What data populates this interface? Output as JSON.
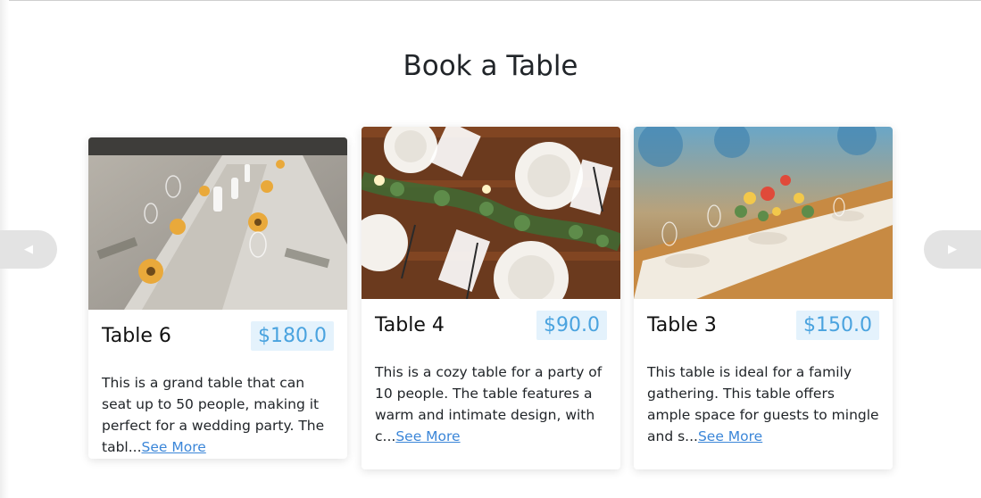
{
  "section": {
    "title": "Book a Table"
  },
  "carousel": {
    "prev_icon": "caret-left-icon",
    "next_icon": "caret-right-icon"
  },
  "cards": [
    {
      "name": "Table 6",
      "price": "$180.0",
      "description": "This is a grand table that can seat up to 50 people, making it perfect for a wedding party. The tabl...",
      "see_more": "See More",
      "image": "table-sunflowers-photo"
    },
    {
      "name": "Table 4",
      "price": "$90.0",
      "description": "This is a cozy table for a party of 10 people. The table features a warm and intimate design, with c...",
      "see_more": "See More",
      "image": "table-greenery-photo"
    },
    {
      "name": "Table 3",
      "price": "$150.0",
      "description": "This table is ideal for a family gathering. This table offers ample space for guests to mingle and s...",
      "see_more": "See More",
      "image": "table-floral-photo"
    }
  ],
  "colors": {
    "price_text": "#4aa3df",
    "price_bg": "#e4f2fc",
    "link": "#3b86d8",
    "arrow_bg": "#e3e3e3"
  }
}
